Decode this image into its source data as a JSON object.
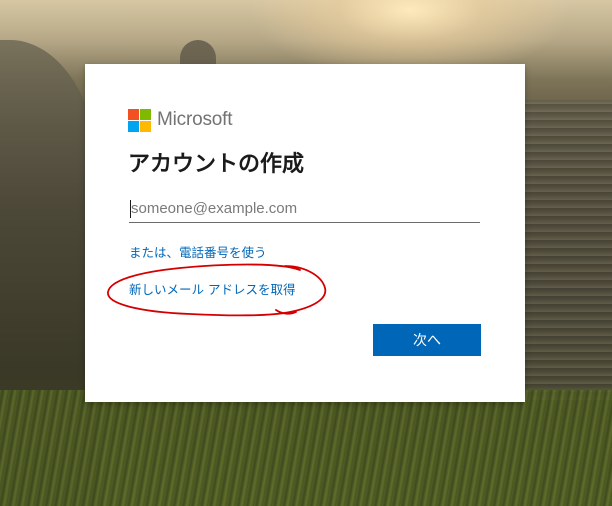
{
  "brand": {
    "name": "Microsoft"
  },
  "colors": {
    "logo_red": "#f25022",
    "logo_green": "#7fba00",
    "logo_blue": "#00a4ef",
    "logo_yellow": "#ffb900",
    "link": "#0067b8",
    "button": "#0067b8",
    "annotation": "#d40000"
  },
  "form": {
    "title": "アカウントの作成",
    "email_placeholder": "someone@example.com",
    "email_value": "",
    "phone_link": "または、電話番号を使う",
    "new_email_link": "新しいメール アドレスを取得",
    "next_label": "次へ"
  },
  "icons": [
    "microsoft-logo-icon"
  ]
}
